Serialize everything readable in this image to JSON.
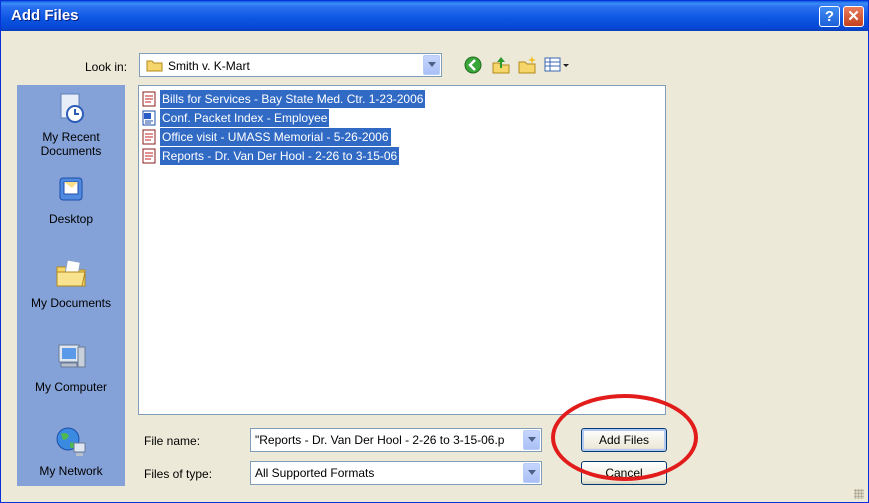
{
  "window": {
    "title": "Add Files",
    "help_glyph": "?",
    "close_glyph": "✕"
  },
  "look_in": {
    "label": "Look in:",
    "value": "Smith v. K-Mart"
  },
  "places": [
    {
      "label": "My Recent\nDocuments",
      "icon": "recent-documents-icon"
    },
    {
      "label": "Desktop",
      "icon": "desktop-icon"
    },
    {
      "label": "My Documents",
      "icon": "my-documents-icon"
    },
    {
      "label": "My Computer",
      "icon": "my-computer-icon"
    },
    {
      "label": "My Network",
      "icon": "my-network-icon"
    }
  ],
  "files": [
    {
      "name": "Bills for Services - Bay State Med. Ctr. 1-23-2006",
      "type": "pdf"
    },
    {
      "name": "Conf. Packet Index - Employee",
      "type": "doc"
    },
    {
      "name": "Office visit - UMASS Memorial - 5-26-2006",
      "type": "pdf"
    },
    {
      "name": "Reports - Dr. Van Der Hool - 2-26 to 3-15-06",
      "type": "pdf"
    }
  ],
  "file_name": {
    "label": "File name:",
    "value": "\"Reports - Dr. Van Der Hool - 2-26 to 3-15-06.p"
  },
  "file_type": {
    "label": "Files of type:",
    "value": "All Supported Formats"
  },
  "buttons": {
    "add_files": "Add Files",
    "cancel": "Cancel"
  },
  "colors": {
    "selection": "#316ac5",
    "annotation_ring": "#e21b1b",
    "places_bar": "#84a2d8"
  }
}
